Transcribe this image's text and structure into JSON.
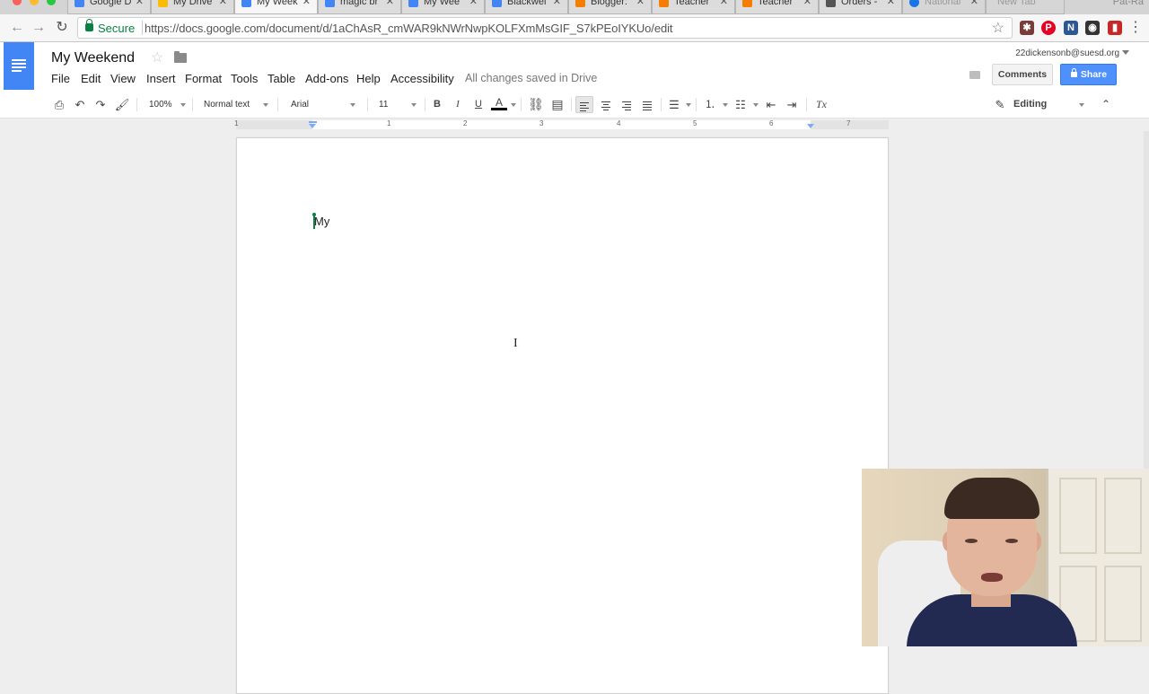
{
  "browser": {
    "tabs": [
      {
        "label": "Google D",
        "icon_color": "#4285f4",
        "active": false
      },
      {
        "label": "My Drive",
        "icon_color": "#fbbc05",
        "active": false
      },
      {
        "label": "My Week",
        "icon_color": "#4285f4",
        "active": true
      },
      {
        "label": "magic br",
        "icon_color": "#4285f4",
        "active": false
      },
      {
        "label": "My Wee",
        "icon_color": "#4285f4",
        "active": false
      },
      {
        "label": "Blackwel",
        "icon_color": "#4285f4",
        "active": false
      },
      {
        "label": "Blogger:",
        "icon_color": "#f57d00",
        "active": false
      },
      {
        "label": "Teacher",
        "icon_color": "#f57d00",
        "active": false
      },
      {
        "label": "Teacher",
        "icon_color": "#f57d00",
        "active": false
      },
      {
        "label": "Orders -",
        "icon_color": "#555555",
        "active": false
      },
      {
        "label": "National",
        "icon_color": "#1a73e8",
        "active": false
      },
      {
        "label": "New Tab",
        "icon_color": "",
        "active": false
      }
    ],
    "user_label": "Pat-Ra",
    "secure_label": "Secure",
    "url": "https://docs.google.com/document/d/1aChAsR_cmWAR9kNWrNwpKOLFXmMsGIF_S7kPEoIYKUo/edit"
  },
  "docs": {
    "title": "My Weekend",
    "menu": [
      "File",
      "Edit",
      "View",
      "Insert",
      "Format",
      "Tools",
      "Table",
      "Add-ons",
      "Help",
      "Accessibility"
    ],
    "saved_status": "All changes saved in Drive",
    "account": "22dickensonb@suesd.org",
    "comments_label": "Comments",
    "share_label": "Share",
    "accent_color": "#4285f4"
  },
  "toolbar": {
    "zoom": "100%",
    "style": "Normal text",
    "font": "Arial",
    "size": "11",
    "bold": "B",
    "italic": "I",
    "underline": "U",
    "text_color_glyph": "A",
    "clear_format_glyph": "Tx",
    "mode": "Editing"
  },
  "ruler": {
    "numbers": [
      "1",
      "1",
      "2",
      "3",
      "4",
      "5",
      "6",
      "7"
    ]
  },
  "document": {
    "body_text": "My"
  }
}
